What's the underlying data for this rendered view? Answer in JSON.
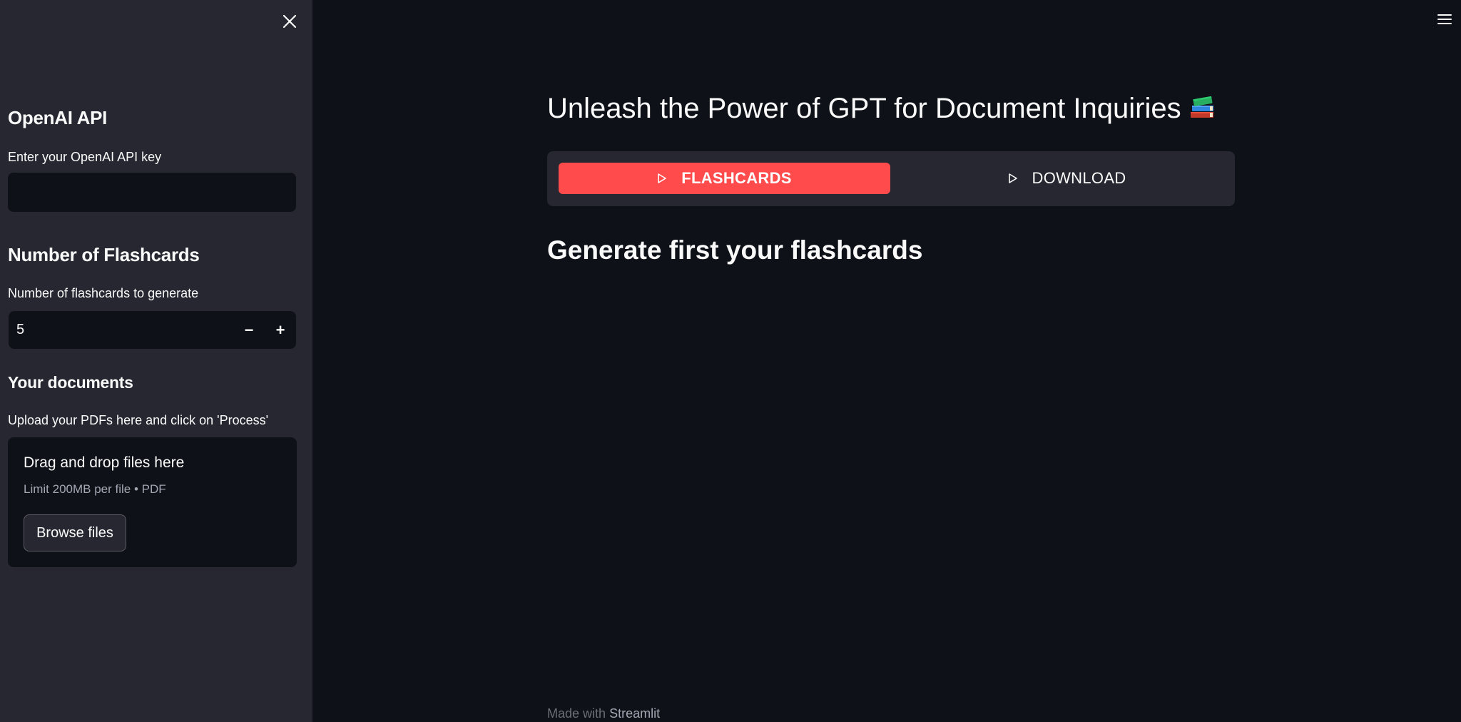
{
  "sidebar": {
    "close_icon": "close-icon",
    "api_section": {
      "heading": "OpenAI API",
      "label": "Enter your OpenAI API key",
      "value": ""
    },
    "flashcards_section": {
      "heading": "Number of Flashcards",
      "label": "Number of flashcards to generate",
      "value": "5",
      "decrement_symbol": "−",
      "increment_symbol": "+"
    },
    "documents_section": {
      "heading": "Your documents",
      "label": "Upload your PDFs here and click on 'Process'",
      "dropzone_title": "Drag and drop files here",
      "dropzone_limit": "Limit 200MB per file • PDF",
      "browse_label": "Browse files"
    }
  },
  "header": {
    "menu_icon": "hamburger-menu-icon"
  },
  "main": {
    "title": "Unleash the Power of GPT for Document Inquiries",
    "title_icon": "books-icon",
    "tabs": [
      {
        "label": "FLASHCARDS",
        "icon": "play-outline-icon",
        "active": true
      },
      {
        "label": "DOWNLOAD",
        "icon": "play-outline-icon",
        "active": false
      }
    ],
    "subtitle": "Generate first your flashcards"
  },
  "footer": {
    "prefix": "Made with",
    "brand": "Streamlit"
  },
  "colors": {
    "background": "#0e1117",
    "sidebar": "#262730",
    "accent": "#ff4b4b",
    "text": "#fafafa"
  }
}
